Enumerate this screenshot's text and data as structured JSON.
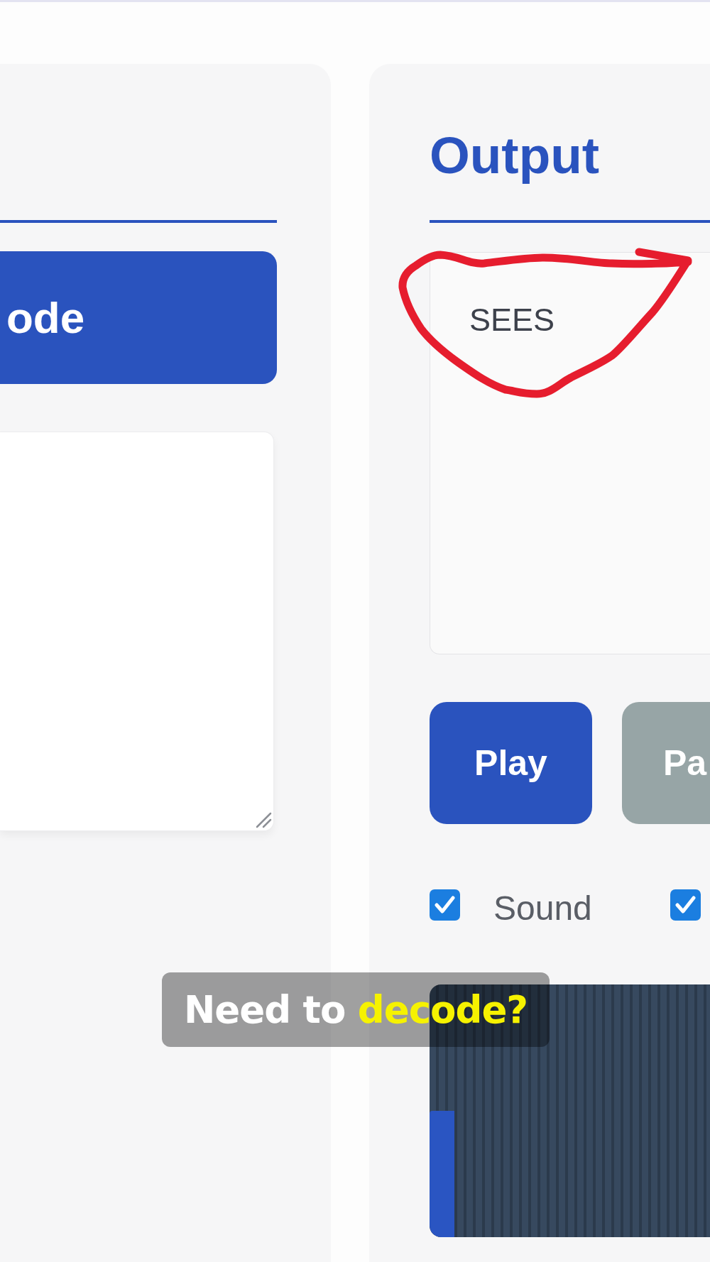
{
  "input": {
    "action_button": {
      "label": "ode"
    }
  },
  "output": {
    "title": "Output",
    "value": "SEES",
    "buttons": [
      {
        "label": "Play",
        "kind": "primary"
      },
      {
        "label": "Pa",
        "kind": "secondary"
      }
    ],
    "options": [
      {
        "label": "Sound",
        "checked": true
      },
      {
        "checked": true
      }
    ]
  },
  "caption": {
    "parts": [
      {
        "text": "Need to",
        "highlight": false
      },
      {
        "text": "decode?",
        "highlight": true
      }
    ]
  }
}
